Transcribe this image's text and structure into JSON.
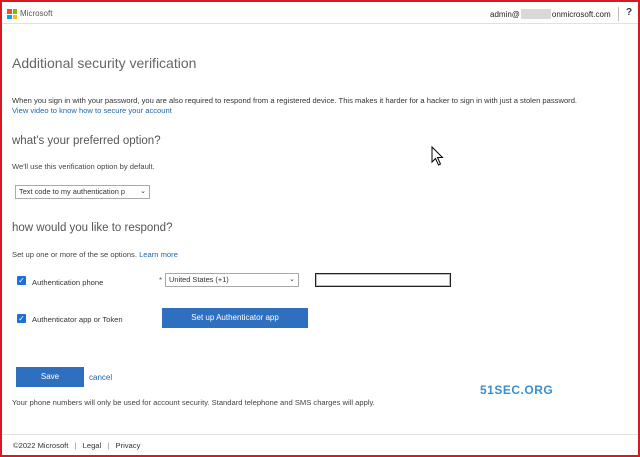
{
  "header": {
    "brand": "Microsoft",
    "account_prefix": "admin@",
    "account_suffix": "onmicrosoft.com",
    "help": "?",
    "logo_colors": [
      "#f25022",
      "#7fba00",
      "#00a4ef",
      "#ffb900"
    ]
  },
  "page": {
    "title": "Additional security verification",
    "description": "When you sign in with your password, you are also required to respond from a registered device. This makes it harder for a hacker to sign in with just a stolen password.",
    "video_link": "View video to know how to secure your account"
  },
  "preferred": {
    "heading": "what's your preferred option?",
    "hint": "We'll use this verification option by default.",
    "selected": "Text code to my authentication p"
  },
  "respond": {
    "heading": "how would you like to respond?",
    "hint": "Set up one or more of the se options.",
    "learn_more": "Learn more",
    "auth_phone": {
      "checked": true,
      "label": "Authentication phone",
      "required_marker": "*",
      "country": "United States (+1)",
      "phone_value": ""
    },
    "auth_app": {
      "checked": true,
      "label": "Authenticator app or Token",
      "setup_button": "Set up Authenticator app"
    }
  },
  "actions": {
    "save": "Save",
    "cancel": "cancel"
  },
  "note": "Your phone numbers will only be used for account security. Standard telephone and SMS charges will apply.",
  "watermark": "51SEC.ORG",
  "footer": {
    "copyright": "©2022 Microsoft",
    "legal": "Legal",
    "privacy": "Privacy",
    "separator": "|"
  },
  "colors": {
    "accent": "#2f6fbf",
    "link": "#2266aa",
    "frame": "#d71920"
  }
}
